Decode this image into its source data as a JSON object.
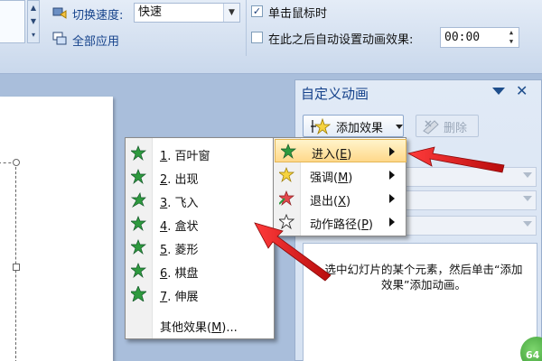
{
  "ribbon": {
    "speed_label": "切换速度:",
    "speed_value": "快速",
    "apply_all_label": "全部应用",
    "on_click_label": "单击鼠标时",
    "on_click_checked": true,
    "auto_after_label": "在此之后自动设置动画效果:",
    "auto_after_checked": false,
    "auto_after_time": "00:00"
  },
  "task_pane": {
    "title": "自定义动画",
    "add_effect_label": "添加效果",
    "delete_label": "删除",
    "hint": "选中幻灯片的某个元素，然后单击“添加效果”添加动画。"
  },
  "main_menu": {
    "items": [
      {
        "label": "进入(",
        "accel": "E",
        "suffix": ")",
        "highlighted": true,
        "icon": "green-star-icon"
      },
      {
        "label": "强调(",
        "accel": "M",
        "suffix": ")",
        "highlighted": false,
        "icon": "yellow-star-icon"
      },
      {
        "label": "退出(",
        "accel": "X",
        "suffix": ")",
        "highlighted": false,
        "icon": "red-star-icon"
      },
      {
        "label": "动作路径(",
        "accel": "P",
        "suffix": ")",
        "highlighted": false,
        "icon": "outline-star-icon"
      }
    ]
  },
  "entrance_menu": {
    "items": [
      {
        "accel": "1",
        "label": ". 百叶窗"
      },
      {
        "accel": "2",
        "label": ". 出现"
      },
      {
        "accel": "3",
        "label": ". 飞入"
      },
      {
        "accel": "4",
        "label": ". 盒状"
      },
      {
        "accel": "5",
        "label": ". 菱形"
      },
      {
        "accel": "6",
        "label": ". 棋盘"
      },
      {
        "accel": "7",
        "label": ". 伸展"
      }
    ],
    "more_label": "其他效果(",
    "more_accel": "M",
    "more_suffix": ")..."
  },
  "badge": "64",
  "colors": {
    "accent": "#15428b",
    "highlight": "#ffd88a",
    "arrow": "#e21b1b",
    "star_green": "#2e9a3e"
  }
}
